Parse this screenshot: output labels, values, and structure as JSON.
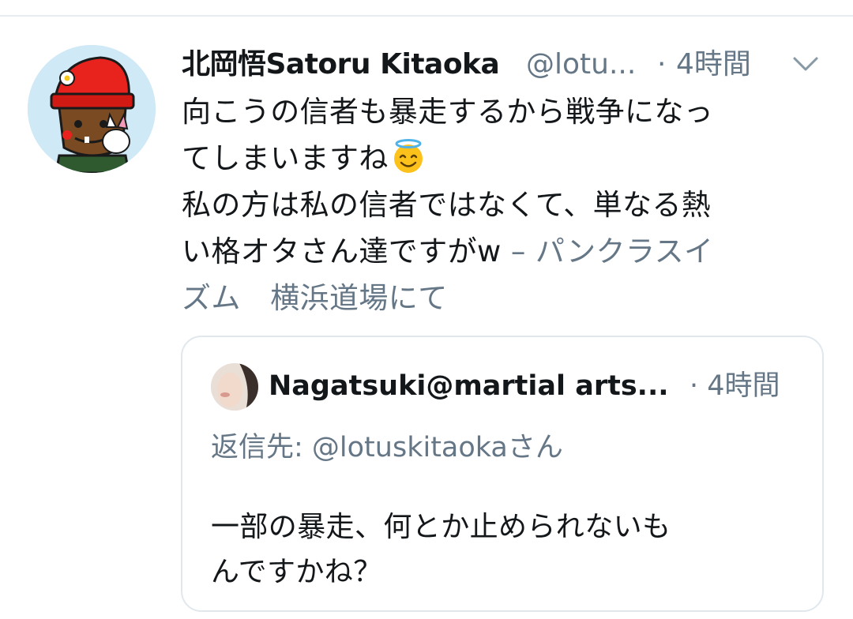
{
  "tweet": {
    "display_name": "北岡悟Satoru Kitaoka",
    "handle": "@lotu...",
    "separator": "·",
    "time": "4時間",
    "text_line1": "向こうの信者も暴走するから戦争になっ",
    "text_line2": "てしまいますね",
    "emoji": "smiling-face-with-halo",
    "text_line3": "私の方は私の信者ではなくて、単なる熱",
    "text_line4": "い格オタさん達ですがw",
    "location_line1": " – パンクラスイ",
    "location_line2": "ズム　横浜道場にて"
  },
  "quoted_tweet": {
    "display_name": "Nagatsuki@martial arts...",
    "time": "· 4時間",
    "reply_to": "返信先: @lotuskitaokaさん",
    "text_line1": "一部の暴走、何とか止められないも",
    "text_line2": "んですかね？"
  },
  "icons": {
    "caret": "chevron-down-icon"
  },
  "colors": {
    "primary_text": "#14171a",
    "secondary_text": "#657786",
    "border": "#e1e8ed"
  }
}
